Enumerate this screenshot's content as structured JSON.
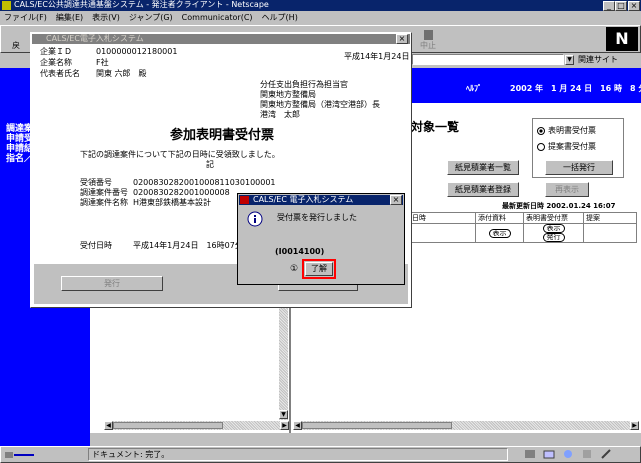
{
  "browser": {
    "title": "CALS/EC公共調達共通基盤システム - 発注者クライアント - Netscape",
    "menu": [
      "ファイル(F)",
      "編集(E)",
      "表示(V)",
      "ジャンプ(G)",
      "Communicator(C)",
      "ヘルプ(H)"
    ],
    "toolbar_label_partial": "戻",
    "toolbar_label_right": "中止",
    "related_sites": "関連サイト",
    "status_text": "ドキュメント: 完了。"
  },
  "app": {
    "header_help": "ﾍﾙﾌﾟ",
    "header_date": "2002 年　1 月 24 日　16 時　8 分",
    "left_nav": [
      "調達案",
      "申請受",
      "申請結",
      "指名／"
    ],
    "section_title": "対象一覧",
    "buttons": {
      "list": "紙見積業者一覧",
      "register": "紙見積業者登録",
      "display": "再表示",
      "batch_issue": "一括発行"
    },
    "radio_options": [
      "表明書受付票",
      "提案書受付票"
    ],
    "last_updated": "最新更新日時 2002.01.24 16:07",
    "table": {
      "headers": [
        "付票発行日時",
        "添付資料",
        "表明書受付票",
        "提案"
      ],
      "row": {
        "datetime": "16:07",
        "attach": "表示",
        "receipt": "表示",
        "receipt2": "発行"
      }
    }
  },
  "doc_window": {
    "title": "CALS/EC電子入札システム",
    "company_id_label": "企業ＩＤ",
    "company_id": "0100000012180001",
    "company_name_label": "企業名称",
    "company_name": "F社",
    "rep_label": "代表者氏名",
    "rep": "関東 六郎　殿",
    "date": "平成14年1月24日",
    "recipient": [
      "分任支出負担行為担当官",
      "関東地方整備局",
      "関東地方整備局（港湾空港部）長",
      "港湾　太郎"
    ],
    "doc_title": "参加表明書受付票",
    "body_text": "下記の調達案件について下記の日時に受領致しました。",
    "ki": "記",
    "receipt_no_label": "受領番号",
    "receipt_no": "0200830282001000811030100001",
    "case_no_label": "調達案件番号",
    "case_no": "0200830282001000008",
    "case_name_label": "調達案件名称",
    "case_name": "H港東部鉄橋基本設計",
    "received_label": "受付日時",
    "received": "平成14年1月24日　16時07分",
    "issue_button": "発行"
  },
  "dialog": {
    "title": "CALS/EC 電子入札システム",
    "message": "受付票を発行しました",
    "code": "(I0014100)",
    "ok_label": "了解",
    "step_marker": "①"
  },
  "colors": {
    "app_blue": "#0000ff",
    "title_blue": "#08246b",
    "highlight_red": "#ff0000"
  }
}
